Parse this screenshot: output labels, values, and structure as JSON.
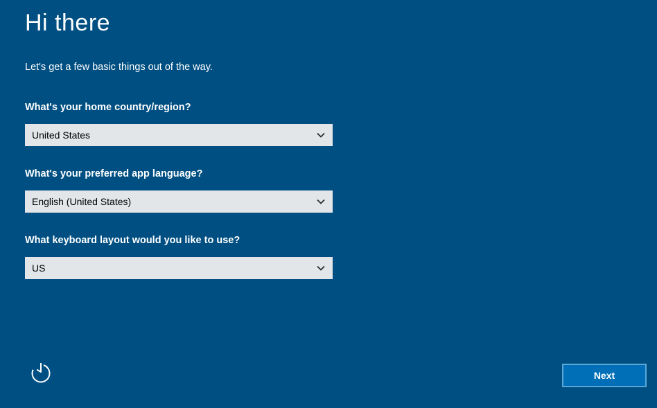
{
  "title": "Hi there",
  "subtitle": "Let's get a few basic things out of the way.",
  "fields": {
    "country": {
      "label": "What's your home country/region?",
      "value": "United States"
    },
    "language": {
      "label": "What's your preferred app language?",
      "value": "English (United States)"
    },
    "keyboard": {
      "label": "What keyboard layout would you like to use?",
      "value": "US"
    }
  },
  "buttons": {
    "next": "Next"
  }
}
